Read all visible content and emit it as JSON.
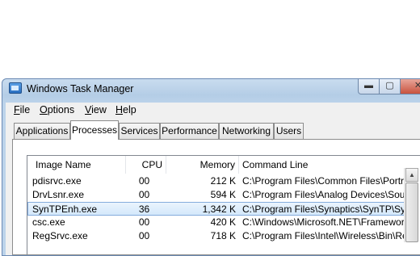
{
  "window": {
    "title": "Windows Task Manager",
    "controls": {
      "minimize": "▬",
      "maximize": "▢",
      "close": "✕"
    }
  },
  "menu": {
    "items": [
      {
        "accel": "F",
        "rest": "ile"
      },
      {
        "accel": "O",
        "rest": "ptions"
      },
      {
        "accel": "V",
        "rest": "iew"
      },
      {
        "accel": "H",
        "rest": "elp"
      }
    ]
  },
  "tabs": [
    {
      "label": "Applications",
      "active": false
    },
    {
      "label": "Processes",
      "active": true
    },
    {
      "label": "Services",
      "active": false
    },
    {
      "label": "Performance",
      "active": false
    },
    {
      "label": "Networking",
      "active": false
    },
    {
      "label": "Users",
      "active": false
    }
  ],
  "processes": {
    "columns": [
      "Image Name",
      "CPU",
      "Memory",
      "Command Line"
    ],
    "rows": [
      {
        "image": "pdisrvc.exe",
        "cpu": "00",
        "memory": "212 K",
        "command": "C:\\Program Files\\Common Files\\Portrait ..."
      },
      {
        "image": "DrvLsnr.exe",
        "cpu": "00",
        "memory": "594 K",
        "command": "C:\\Program Files\\Analog Devices\\Sound..."
      },
      {
        "image": "SynTPEnh.exe",
        "cpu": "36",
        "memory": "1,342 K",
        "command": "C:\\Program Files\\Synaptics\\SynTP\\SynT...",
        "selected": true
      },
      {
        "image": "csc.exe",
        "cpu": "00",
        "memory": "420 K",
        "command": "C:\\Windows\\Microsoft.NET\\Framework\\v..."
      },
      {
        "image": "RegSrvc.exe",
        "cpu": "00",
        "memory": "718 K",
        "command": "C:\\Program Files\\Intel\\Wireless\\Bin\\RegS..."
      }
    ]
  },
  "scrollbar": {
    "up_arrow": "▲"
  }
}
